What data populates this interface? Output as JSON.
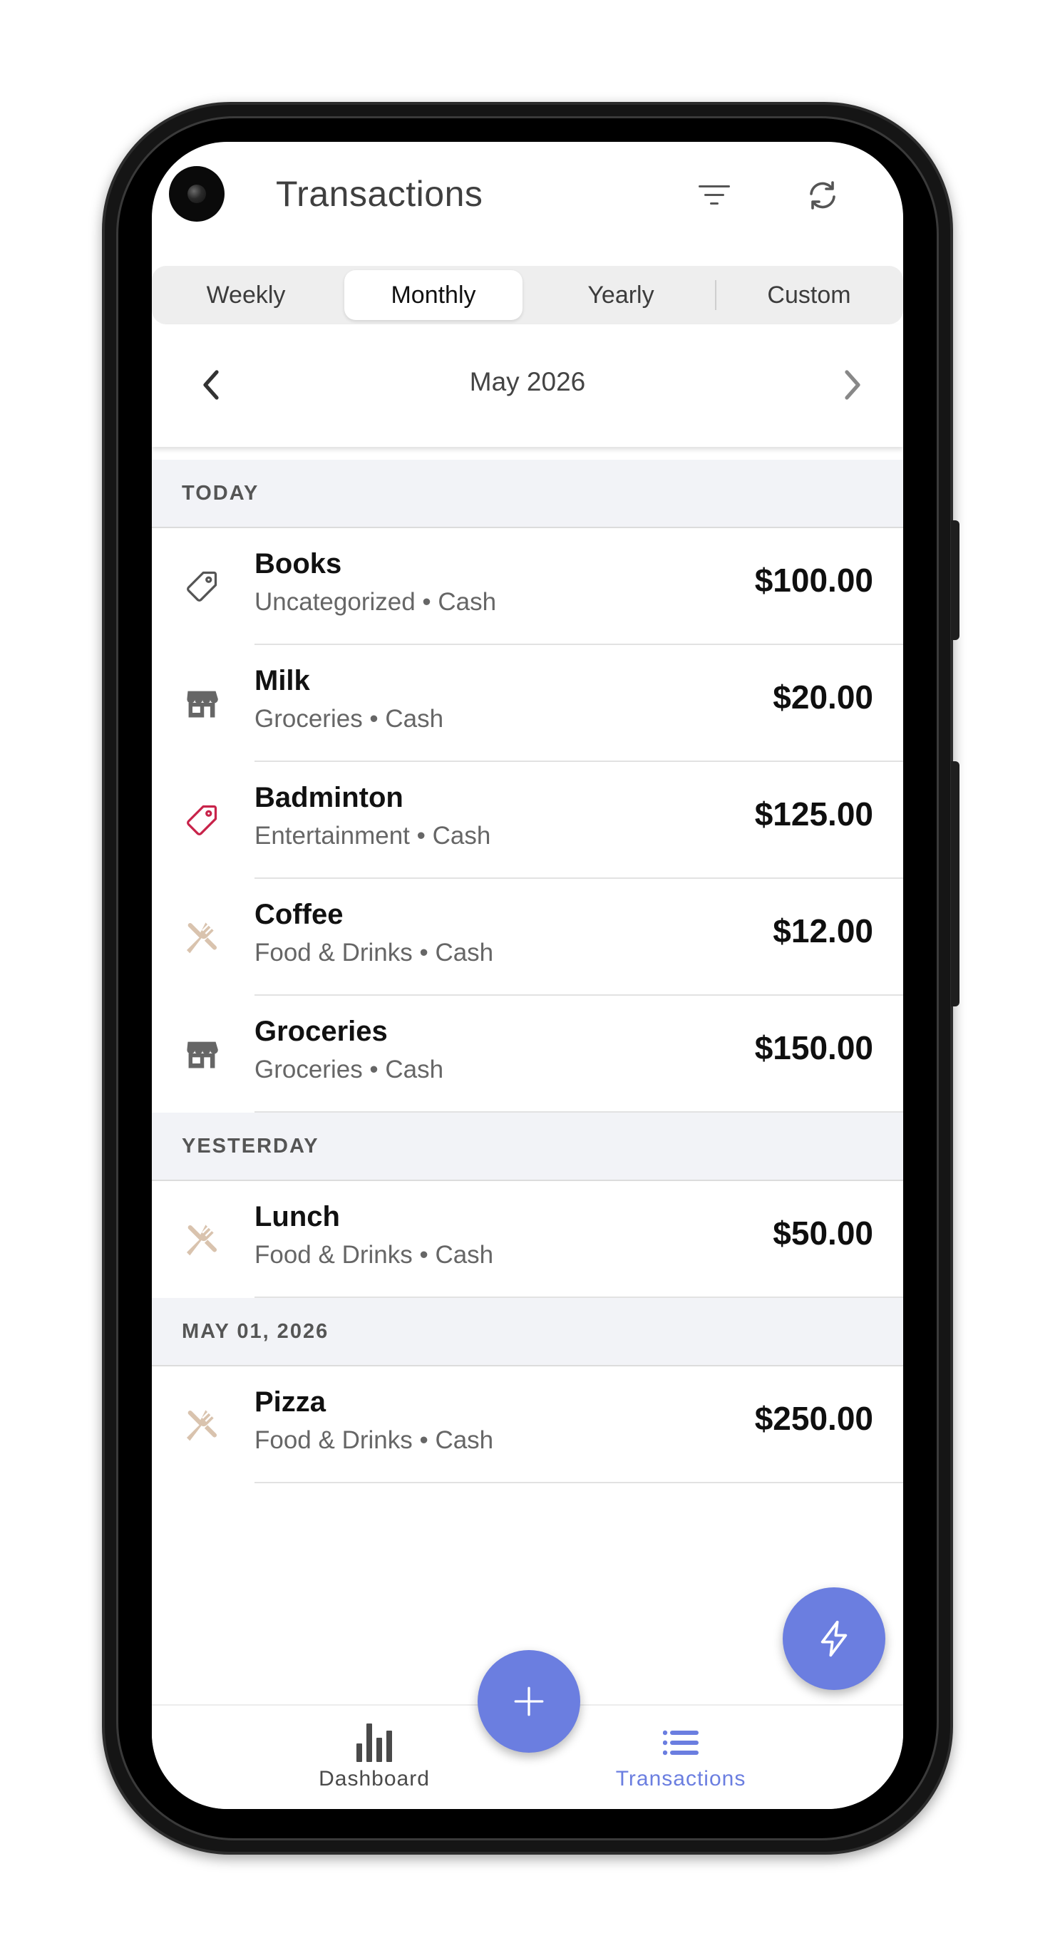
{
  "header": {
    "title": "Transactions",
    "filter_icon": "filter-icon",
    "refresh_icon": "refresh-icon"
  },
  "period_tabs": [
    {
      "label": "Weekly",
      "selected": false
    },
    {
      "label": "Monthly",
      "selected": true
    },
    {
      "label": "Yearly",
      "selected": false
    },
    {
      "label": "Custom",
      "selected": false
    }
  ],
  "month_nav": {
    "label": "May 2026",
    "prev_icon": "chevron-left-icon",
    "next_icon": "chevron-right-icon"
  },
  "sections": [
    {
      "label": "TODAY",
      "transactions": [
        {
          "title": "Books",
          "subtitle": "Uncategorized • Cash",
          "amount": "$100.00",
          "icon": "tag-icon",
          "icon_color": "#555555"
        },
        {
          "title": "Milk",
          "subtitle": "Groceries • Cash",
          "amount": "$20.00",
          "icon": "store-icon",
          "icon_color": "#666666"
        },
        {
          "title": "Badminton",
          "subtitle": "Entertainment • Cash",
          "amount": "$125.00",
          "icon": "tag-icon",
          "icon_color": "#c8234a"
        },
        {
          "title": "Coffee",
          "subtitle": "Food & Drinks • Cash",
          "amount": "$12.00",
          "icon": "utensils-icon",
          "icon_color": "#d9c3ae"
        },
        {
          "title": "Groceries",
          "subtitle": "Groceries • Cash",
          "amount": "$150.00",
          "icon": "store-icon",
          "icon_color": "#666666"
        }
      ]
    },
    {
      "label": "YESTERDAY",
      "transactions": [
        {
          "title": "Lunch",
          "subtitle": "Food & Drinks • Cash",
          "amount": "$50.00",
          "icon": "utensils-icon",
          "icon_color": "#d9c3ae"
        }
      ]
    },
    {
      "label": "MAY 01, 2026",
      "transactions": [
        {
          "title": "Pizza",
          "subtitle": "Food & Drinks • Cash",
          "amount": "$250.00",
          "icon": "utensils-icon",
          "icon_color": "#d9c3ae"
        }
      ]
    }
  ],
  "fabs": {
    "quick_add_icon": "flash-icon",
    "add_icon": "plus-icon",
    "color": "#6b7ee0"
  },
  "bottom_nav": [
    {
      "label": "Dashboard",
      "icon": "bar-chart-icon",
      "active": false
    },
    {
      "label": "Transactions",
      "icon": "list-icon",
      "active": true
    }
  ],
  "colors": {
    "accent": "#6b7ee0",
    "section_bg": "#f2f3f7"
  }
}
